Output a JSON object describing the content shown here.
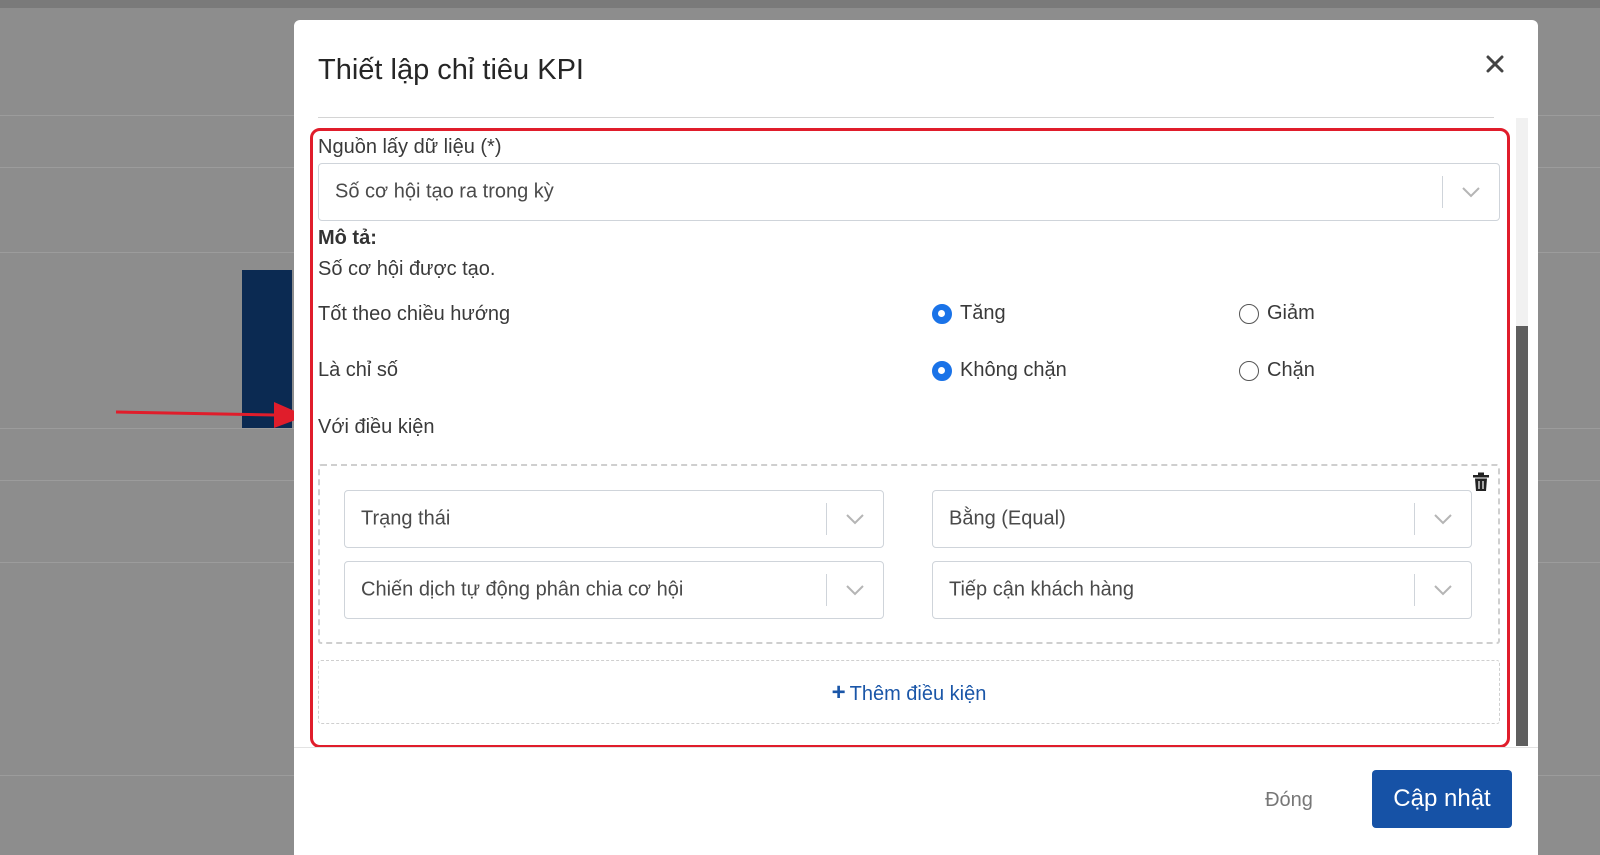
{
  "modal": {
    "title": "Thiết lập chỉ tiêu KPI",
    "close_icon": "close-icon"
  },
  "data_source": {
    "label": "Nguồn lấy dữ liệu (*)",
    "value": "Số cơ hội tạo ra trong kỳ"
  },
  "description": {
    "label": "Mô tả:",
    "text": "Số cơ hội được tạo."
  },
  "direction": {
    "label": "Tốt theo chiều hướng",
    "options": [
      {
        "label": "Tăng",
        "selected": true
      },
      {
        "label": "Giảm",
        "selected": false
      }
    ]
  },
  "indicator": {
    "label": "Là chỉ số",
    "options": [
      {
        "label": "Không chặn",
        "selected": true
      },
      {
        "label": "Chặn",
        "selected": false
      }
    ]
  },
  "conditions": {
    "label": "Với điều kiện",
    "field": "Trạng thái",
    "operator": "Bằng (Equal)",
    "context": "Chiến dịch tự động phân chia cơ hội",
    "value": "Tiếp cận khách hàng",
    "add_label": "Thêm điều kiện"
  },
  "footer": {
    "close_label": "Đóng",
    "update_label": "Cập nhật"
  },
  "colors": {
    "primary": "#1652a6",
    "highlight": "#e01d2b",
    "radio_checked": "#1a73e8"
  }
}
